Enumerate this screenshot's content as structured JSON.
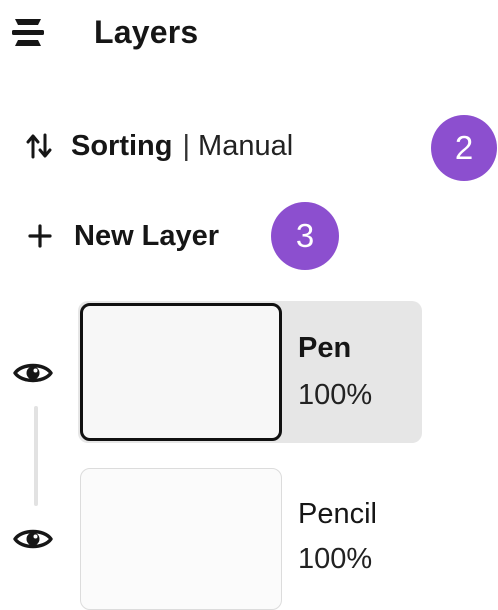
{
  "header": {
    "menu_icon": "layers-menu-icon",
    "title": "Layers"
  },
  "sorting": {
    "icon": "sort-arrows-icon",
    "label": "Sorting",
    "separator": "|",
    "value": "Manual"
  },
  "new_layer": {
    "icon": "plus-icon",
    "label": "New Layer"
  },
  "badges": [
    {
      "text": "2",
      "color": "#8c4fcf"
    },
    {
      "text": "3",
      "color": "#8c4fcf"
    }
  ],
  "layers": [
    {
      "name": "Pen",
      "opacity": "100%",
      "visible": true,
      "selected": true,
      "visibility_icon": "eye-icon"
    },
    {
      "name": "Pencil",
      "opacity": "100%",
      "visible": true,
      "selected": false,
      "visibility_icon": "eye-icon"
    }
  ],
  "colors": {
    "accent": "#8c4fcf",
    "selected_row": "#e6e6e6",
    "text": "#161616"
  }
}
